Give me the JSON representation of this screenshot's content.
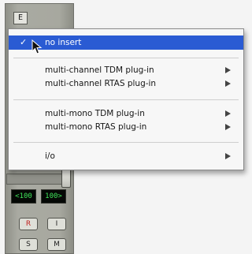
{
  "menu": {
    "selected_check": "✓",
    "items": [
      {
        "label": "no insert",
        "checked": true,
        "submenu": false
      },
      {
        "label": "multi-channel TDM plug-in",
        "submenu": true
      },
      {
        "label": "multi-channel RTAS plug-in",
        "submenu": true
      },
      {
        "label": "multi-mono TDM plug-in",
        "submenu": true
      },
      {
        "label": "multi-mono RTAS plug-in",
        "submenu": true
      },
      {
        "label": "i/o",
        "submenu": true
      }
    ]
  },
  "strip": {
    "insert_slot_label": "E",
    "pan_left": "<100",
    "pan_right": "100>",
    "rec_label": "R",
    "input_label": "I",
    "solo_label": "S",
    "mute_label": "M"
  },
  "colors": {
    "highlight": "#2a5bd3",
    "pan_text": "#3fe45a"
  }
}
